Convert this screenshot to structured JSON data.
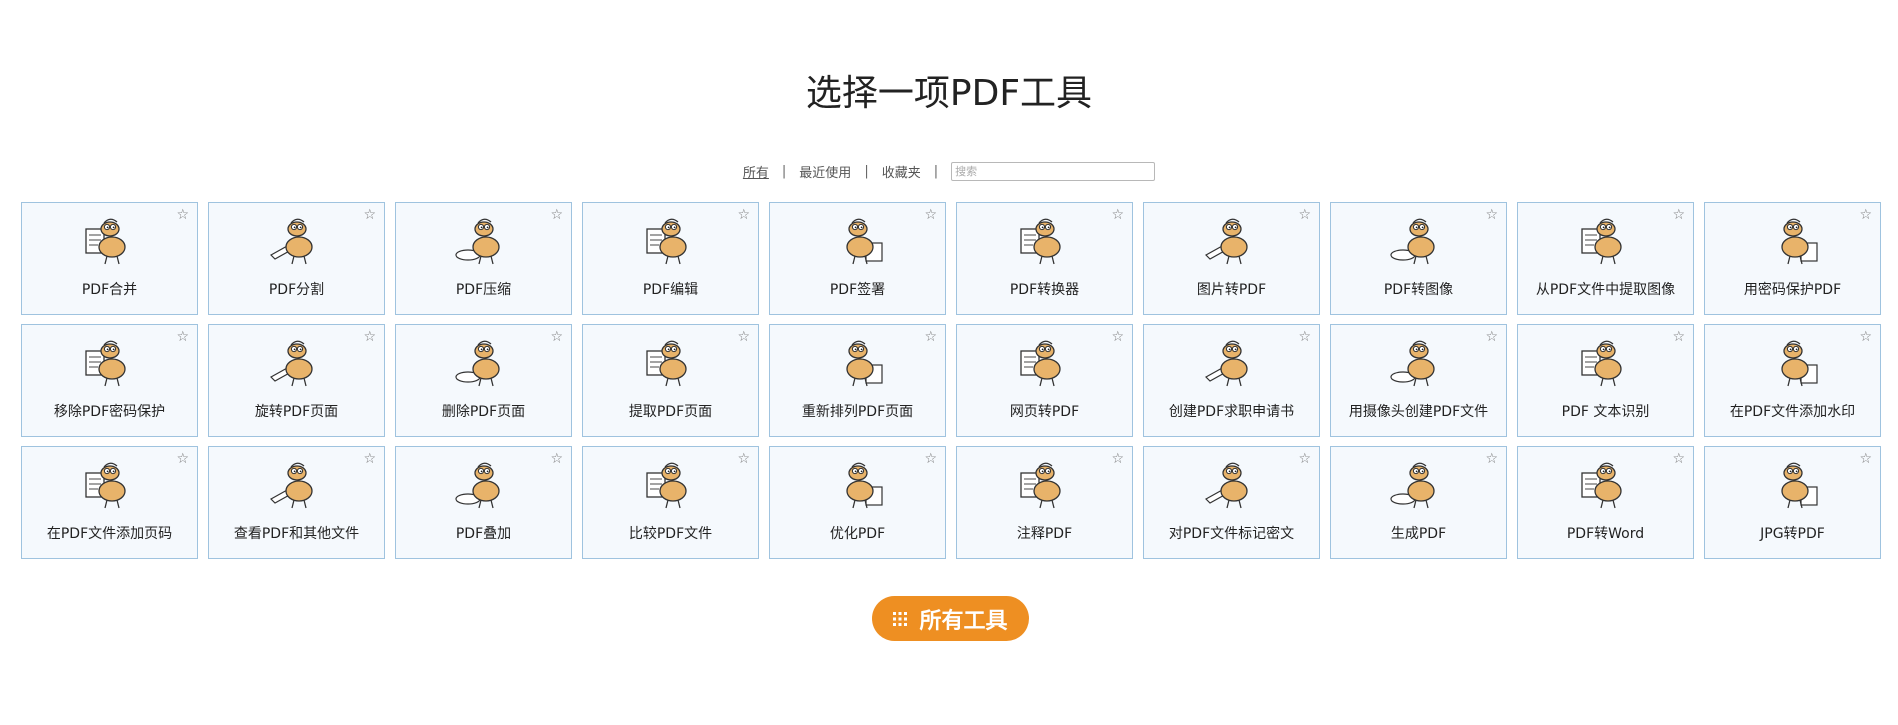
{
  "heading": "选择一项PDF工具",
  "filters": {
    "all": "所有",
    "recent": "最近使用",
    "favorites": "收藏夹",
    "separator": "|",
    "search_placeholder": "搜索"
  },
  "star_icon": "☆",
  "tools": [
    {
      "label": "PDF合并",
      "icon": "merge-illustration-icon"
    },
    {
      "label": "PDF分割",
      "icon": "axe-split-illustration-icon"
    },
    {
      "label": "PDF压缩",
      "icon": "compress-vise-illustration-icon"
    },
    {
      "label": "PDF编辑",
      "icon": "edit-illustration-icon"
    },
    {
      "label": "PDF签署",
      "icon": "signature-illustration-icon"
    },
    {
      "label": "PDF转换器",
      "icon": "converter-illustration-icon"
    },
    {
      "label": "图片转PDF",
      "icon": "image-to-pdf-illustration-icon"
    },
    {
      "label": "PDF转图像",
      "icon": "pdf-to-image-illustration-icon"
    },
    {
      "label": "从PDF文件中提取图像",
      "icon": "extract-images-illustration-icon"
    },
    {
      "label": "用密码保护PDF",
      "icon": "password-protect-illustration-icon"
    },
    {
      "label": "移除PDF密码保护",
      "icon": "unlock-illustration-icon"
    },
    {
      "label": "旋转PDF页面",
      "icon": "rotate-illustration-icon"
    },
    {
      "label": "删除PDF页面",
      "icon": "delete-pages-illustration-icon"
    },
    {
      "label": "提取PDF页面",
      "icon": "extract-pages-illustration-icon"
    },
    {
      "label": "重新排列PDF页面",
      "icon": "rearrange-illustration-icon"
    },
    {
      "label": "网页转PDF",
      "icon": "web-to-pdf-illustration-icon"
    },
    {
      "label": "创建PDF求职申请书",
      "icon": "job-application-illustration-icon"
    },
    {
      "label": "用摄像头创建PDF文件",
      "icon": "camera-illustration-icon"
    },
    {
      "label": "PDF 文本识别",
      "icon": "ocr-illustration-icon"
    },
    {
      "label": "在PDF文件添加水印",
      "icon": "watermark-illustration-icon"
    },
    {
      "label": "在PDF文件添加页码",
      "icon": "page-numbers-123-illustration-icon"
    },
    {
      "label": "查看PDF和其他文件",
      "icon": "magnifier-illustration-icon"
    },
    {
      "label": "PDF叠加",
      "icon": "overlay-illustration-icon"
    },
    {
      "label": "比较PDF文件",
      "icon": "compare-illustration-icon"
    },
    {
      "label": "优化PDF",
      "icon": "optimize-illustration-icon"
    },
    {
      "label": "注释PDF",
      "icon": "speech-bubble-illustration-icon"
    },
    {
      "label": "对PDF文件标记密文",
      "icon": "redact-top-hat-illustration-icon"
    },
    {
      "label": "生成PDF",
      "icon": "create-pdf-illustration-icon"
    },
    {
      "label": "PDF转Word",
      "icon": "pdf-to-word-illustration-icon"
    },
    {
      "label": "JPG转PDF",
      "icon": "jpg-to-pdf-illustration-icon"
    }
  ],
  "all_tools_button": {
    "label": "所有工具",
    "icon": "grid-icon"
  },
  "colors": {
    "accent": "#ee8f22",
    "card_border": "#9fc3df",
    "card_background": "#f5f9fd",
    "mascot": "#e8b36a"
  }
}
